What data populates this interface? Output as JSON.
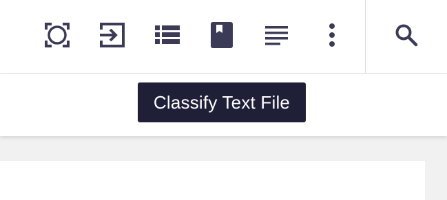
{
  "toolbar": {
    "buttons": [
      {
        "icon": "capture-region-icon"
      },
      {
        "icon": "import-icon"
      },
      {
        "icon": "list-view-icon"
      },
      {
        "icon": "bookmark-icon",
        "active": true
      },
      {
        "icon": "text-lines-icon"
      },
      {
        "icon": "more-vertical-icon"
      },
      {
        "icon": "search-icon"
      }
    ]
  },
  "tooltip": {
    "text": "Classify Text File"
  },
  "colors": {
    "icon": "#3b3b57",
    "tooltip_bg": "#1f1f38",
    "tooltip_text": "#ffffff",
    "background": "#f1f1f1"
  }
}
